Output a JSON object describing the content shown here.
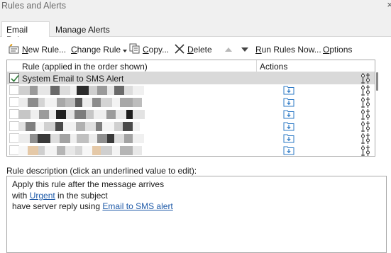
{
  "window": {
    "title": "Rules and Alerts",
    "close_glyph": "×"
  },
  "tabs": [
    {
      "label": "Email Rules",
      "active": true
    },
    {
      "label": "Manage Alerts",
      "active": false
    }
  ],
  "toolbar": {
    "new_rule": {
      "label": "New Rule...",
      "icon": "new-rule-icon"
    },
    "change_rule": {
      "label": "Change Rule",
      "icon": "dropdown-arrow-icon"
    },
    "copy": {
      "label": "Copy...",
      "icon": "copy-icon"
    },
    "delete": {
      "label": "Delete",
      "icon": "delete-x-icon"
    },
    "move_up": {
      "icon": "move-up-icon",
      "enabled": false
    },
    "move_down": {
      "icon": "move-down-icon",
      "enabled": true
    },
    "run_rules_now": {
      "label": "Run Rules Now..."
    },
    "options": {
      "label": "Options"
    }
  },
  "rules_table": {
    "columns": [
      "Rule (applied in the order shown)",
      "Actions"
    ],
    "rows": [
      {
        "name": "System Email to SMS Alert",
        "checked": true,
        "selected": true,
        "redacted": false
      },
      {
        "name": "",
        "checked": false,
        "selected": false,
        "redacted": true
      },
      {
        "name": "",
        "checked": false,
        "selected": false,
        "redacted": true
      },
      {
        "name": "",
        "checked": false,
        "selected": false,
        "redacted": true
      },
      {
        "name": "",
        "checked": false,
        "selected": false,
        "redacted": true
      },
      {
        "name": "",
        "checked": false,
        "selected": false,
        "redacted": true
      },
      {
        "name": "",
        "checked": false,
        "selected": false,
        "redacted": true
      }
    ]
  },
  "description": {
    "label": "Rule description (click an underlined value to edit):",
    "line1": "Apply this rule after the message arrives",
    "line2_prefix": "with ",
    "line2_link": "Urgent",
    "line2_suffix": " in the subject",
    "line3_prefix": "have server reply using ",
    "line3_link": "Email to SMS alert"
  },
  "colors": {
    "link": "#1e5aa8",
    "selected_row": "#d9d9d9",
    "icon_blue": "#2b78c5"
  }
}
